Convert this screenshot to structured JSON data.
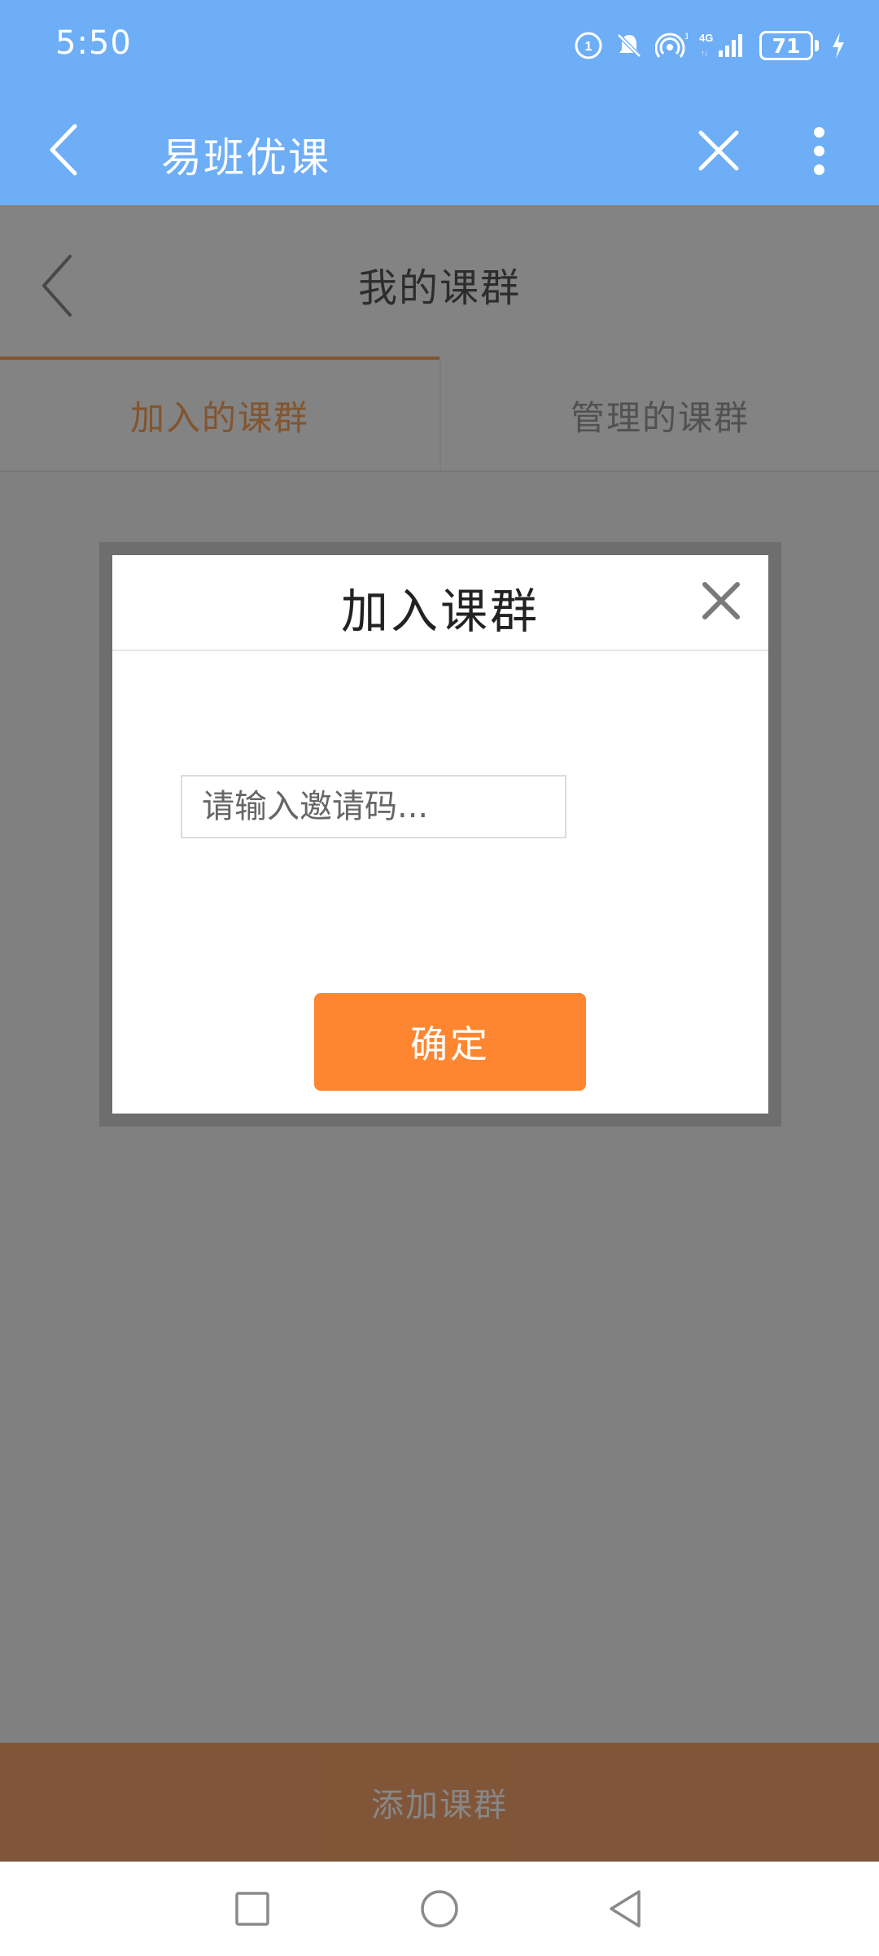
{
  "status_bar": {
    "time": "5:50",
    "battery_level": "71",
    "icons": [
      "hd-call-icon",
      "bell-muted-icon",
      "hotspot-icon",
      "signal-4g-icon",
      "battery-icon",
      "charging-icon"
    ]
  },
  "app_bar": {
    "title": "易班优课",
    "back_icon": "chevron-left-icon",
    "close_icon": "close-icon",
    "more_icon": "more-vertical-icon"
  },
  "page": {
    "title": "我的课群",
    "tabs": [
      {
        "label": "加入的课群",
        "active": true
      },
      {
        "label": "管理的课群",
        "active": false
      }
    ],
    "add_button_label": "添加课群"
  },
  "dialog": {
    "title": "加入课群",
    "input_placeholder": "请输入邀请码...",
    "input_value": "",
    "confirm_label": "确定"
  },
  "nav_bar": {
    "icons": [
      "recent-apps-icon",
      "home-icon",
      "back-icon"
    ]
  },
  "colors": {
    "app_bar": "#6daef7",
    "accent_orange": "#fe8630",
    "tab_active": "#f5a05a"
  }
}
